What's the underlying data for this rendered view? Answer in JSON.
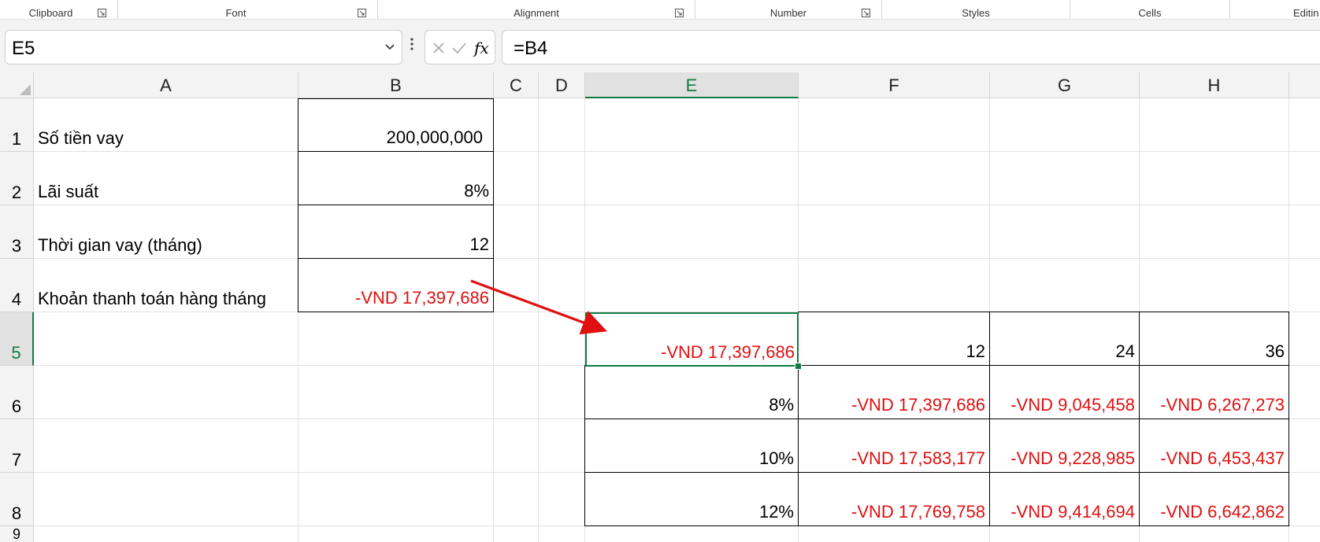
{
  "ribbon": {
    "groups": [
      {
        "label": "Clipboard",
        "launcher": true
      },
      {
        "label": "Font",
        "launcher": true
      },
      {
        "label": "Alignment",
        "launcher": true
      },
      {
        "label": "Number",
        "launcher": true
      },
      {
        "label": "Styles",
        "launcher": false
      },
      {
        "label": "Cells",
        "launcher": false
      },
      {
        "label": "Editin",
        "launcher": false
      }
    ]
  },
  "formula_bar": {
    "name_box": "E5",
    "formula": "=B4",
    "fx_label": "fx"
  },
  "columns": [
    "A",
    "B",
    "C",
    "D",
    "E",
    "F",
    "G",
    "H"
  ],
  "selected_column": "E",
  "rows": [
    "1",
    "2",
    "3",
    "4",
    "5",
    "6",
    "7",
    "8",
    "9"
  ],
  "selected_row": "5",
  "cells": {
    "A1": "Số tiền vay",
    "B1": "200,000,000",
    "A2": "Lãi suất",
    "B2": "8%",
    "A3": "Thời gian vay (tháng)",
    "B3": "12",
    "A4": "Khoản thanh toán hàng tháng",
    "B4": "-VND 17,397,686",
    "E5": "-VND 17,397,686",
    "F5": "12",
    "G5": "24",
    "H5": "36",
    "E6": "8%",
    "F6": "-VND 17,397,686",
    "G6": "-VND 9,045,458",
    "H6": "-VND 6,267,273",
    "E7": "10%",
    "F7": "-VND 17,583,177",
    "G7": "-VND 9,228,985",
    "H7": "-VND 6,453,437",
    "E8": "12%",
    "F8": "-VND 17,769,758",
    "G8": "-VND 9,414,694",
    "H8": "-VND 6,642,862"
  },
  "colors": {
    "negative": "#e01010",
    "selection": "#107c41",
    "annotation_arrow": "#e01010"
  }
}
